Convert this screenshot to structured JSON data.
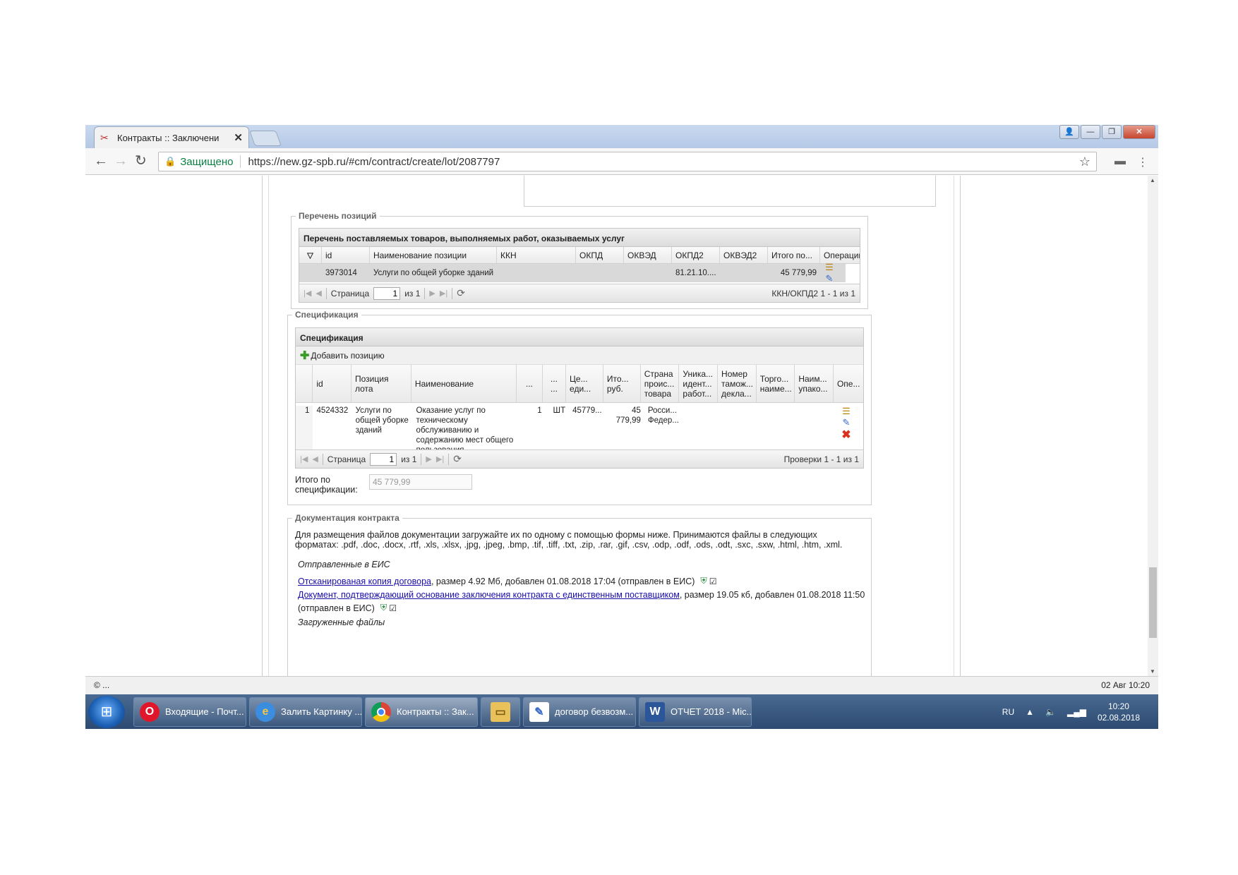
{
  "browser": {
    "tab_title": "Контракты :: Заключени",
    "secure_label": "Защищено",
    "url": "https://new.gz-spb.ru/#cm/contract/create/lot/2087797"
  },
  "positions": {
    "legend": "Перечень позиций",
    "grid_title": "Перечень поставляемых товаров, выполняемых работ, оказываемых услуг",
    "columns": [
      "id",
      "Наименование позиции",
      "ККН",
      "ОКПД",
      "ОКВЭД",
      "ОКПД2",
      "ОКВЭД2",
      "Итого по...",
      "Операции"
    ],
    "rows": [
      {
        "id": "3973014",
        "name": "Услуги по общей уборке зданий",
        "kkn": "",
        "okpd": "",
        "okved": "",
        "okpd2": "81.21.10....",
        "okved2": "",
        "total": "45 779,99"
      }
    ],
    "pager": {
      "page_label": "Страница",
      "page": "1",
      "of": "из 1",
      "info": "ККН/ОКПД2 1 - 1 из 1"
    }
  },
  "spec": {
    "legend": "Спецификация",
    "grid_title": "Спецификация",
    "add_label": "Добавить позицию",
    "columns": [
      "id",
      "Позиция лота",
      "Наименование",
      "...",
      "...\n...",
      "Це...\nеди...",
      "Ито...\nруб.",
      "Страна\nпроис...\nтовара",
      "Уника...\nидент...\nработ...",
      "Номер\nтамож...\nдекла...",
      "Торго...\nнаиме...",
      "Наим...\nупако...",
      "Опе..."
    ],
    "rows": [
      {
        "num": "1",
        "id": "4524332",
        "lot": "Услуги по общей уборке зданий",
        "name": "Оказание услуг по техническому обслуживанию и содержанию мест общего пользования",
        "qty": "1",
        "unit": "ШТ",
        "price": "45779...",
        "total": "45\n779,99",
        "country": "Росси...\nФедер..."
      }
    ],
    "pager": {
      "page_label": "Страница",
      "page": "1",
      "of": "из 1",
      "info": "Проверки 1 - 1 из 1"
    },
    "total_label": "Итого по спецификации:",
    "total_value": "45 779,99"
  },
  "docs": {
    "legend": "Документация контракта",
    "intro": "Для размещения файлов документации загружайте их по одному с помощью формы ниже. Принимаются файлы в следующих форматах: .pdf, .doc, .docx, .rtf, .xls, .xlsx, .jpg, .jpeg, .bmp, .tif, .tiff, .txt, .zip, .rar, .gif, .csv, .odp, .odf, .ods, .odt, .sxc, .sxw, .html, .htm, .xml.",
    "sent_heading": "Отправленные в ЕИС",
    "file1_link": "Отсканированая копия договора",
    "file1_meta": ", размер 4.92 Мб, добавлен 01.08.2018 17:04 (отправлен в ЕИС)",
    "file2_link": "Документ, подтверждающий основание заключения контракта с единственным поставщиком",
    "file2_meta": ", размер 19.05 кб, добавлен 01.08.2018 11:50",
    "file2_meta2": "(отправлен в ЕИС)",
    "uploaded_heading": "Загруженные файлы"
  },
  "statusbar": {
    "left": "© ...",
    "right": "02 Авг 10:20"
  },
  "taskbar": {
    "items": [
      "Входящие - Почт...",
      "Залить Картинку ...",
      "Контракты :: Зак...",
      "",
      "договор безвозм...",
      "ОТЧЕТ 2018 - Mic..."
    ],
    "lang": "RU",
    "time": "10:20",
    "date": "02.08.2018"
  }
}
